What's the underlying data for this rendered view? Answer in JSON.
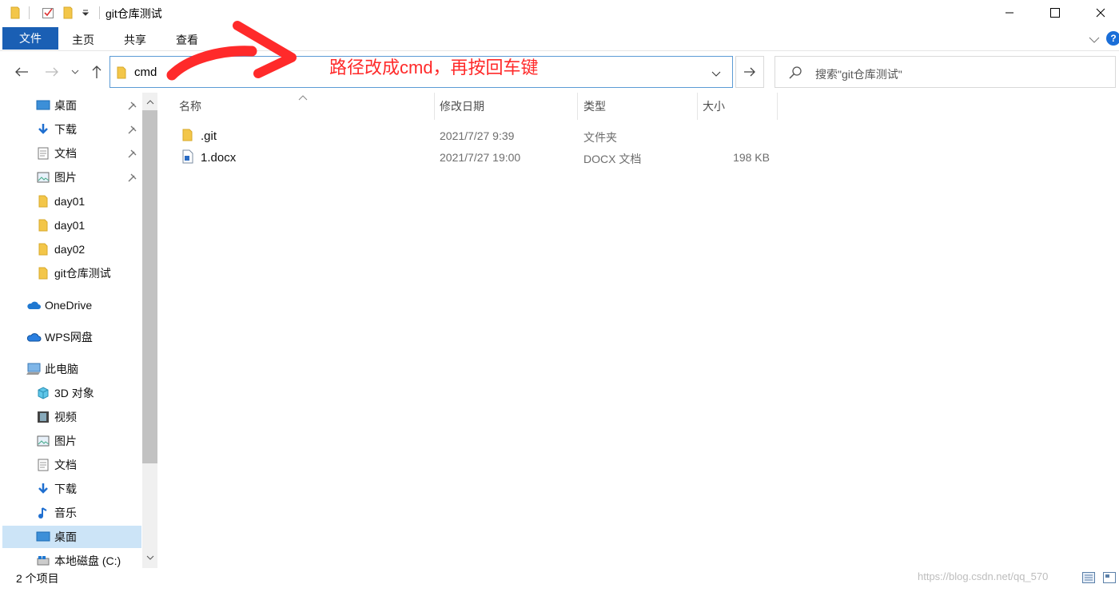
{
  "window": {
    "title": "git仓库测试"
  },
  "ribbon": {
    "tabs": [
      "文件",
      "主页",
      "共享",
      "查看"
    ]
  },
  "address": {
    "value": "cmd"
  },
  "search": {
    "placeholder": "搜索\"git仓库测试\""
  },
  "annotation": {
    "text": "路径改成cmd，再按回车键",
    "color": "#ff2a2a"
  },
  "sidebar": {
    "items": [
      {
        "label": "桌面",
        "icon": "desktop-icon",
        "pinned": true
      },
      {
        "label": "下载",
        "icon": "download-icon",
        "pinned": true
      },
      {
        "label": "文档",
        "icon": "document-icon",
        "pinned": true
      },
      {
        "label": "图片",
        "icon": "picture-icon",
        "pinned": true
      },
      {
        "label": "day01",
        "icon": "folder-icon"
      },
      {
        "label": "day01",
        "icon": "folder-icon"
      },
      {
        "label": "day02",
        "icon": "folder-icon"
      },
      {
        "label": "git仓库测试",
        "icon": "folder-icon"
      },
      {
        "label": "OneDrive",
        "icon": "cloud-icon"
      },
      {
        "label": "WPS网盘",
        "icon": "cloud-icon"
      },
      {
        "label": "此电脑",
        "icon": "pc-icon"
      },
      {
        "label": "3D 对象",
        "icon": "cube-icon"
      },
      {
        "label": "视频",
        "icon": "video-icon"
      },
      {
        "label": "图片",
        "icon": "picture-icon"
      },
      {
        "label": "文档",
        "icon": "document-icon"
      },
      {
        "label": "下载",
        "icon": "download-icon"
      },
      {
        "label": "音乐",
        "icon": "music-icon"
      },
      {
        "label": "桌面",
        "icon": "desktop-icon",
        "selected": true
      },
      {
        "label": "本地磁盘 (C:)",
        "icon": "drive-icon"
      }
    ]
  },
  "list": {
    "columns": [
      "名称",
      "修改日期",
      "类型",
      "大小"
    ],
    "rows": [
      {
        "name": ".git",
        "date": "2021/7/27 9:39",
        "type": "文件夹",
        "size": "",
        "icon": "folder-icon"
      },
      {
        "name": "1.docx",
        "date": "2021/7/27 19:00",
        "type": "DOCX 文档",
        "size": "198 KB",
        "icon": "docx-icon"
      }
    ]
  },
  "status": {
    "count": "2 个项目"
  },
  "watermark": {
    "text": "https://blog.csdn.net/qq_570"
  },
  "colors": {
    "accent": "#1a5fb4",
    "selection": "#cce4f7",
    "folder": "#f3c649"
  }
}
